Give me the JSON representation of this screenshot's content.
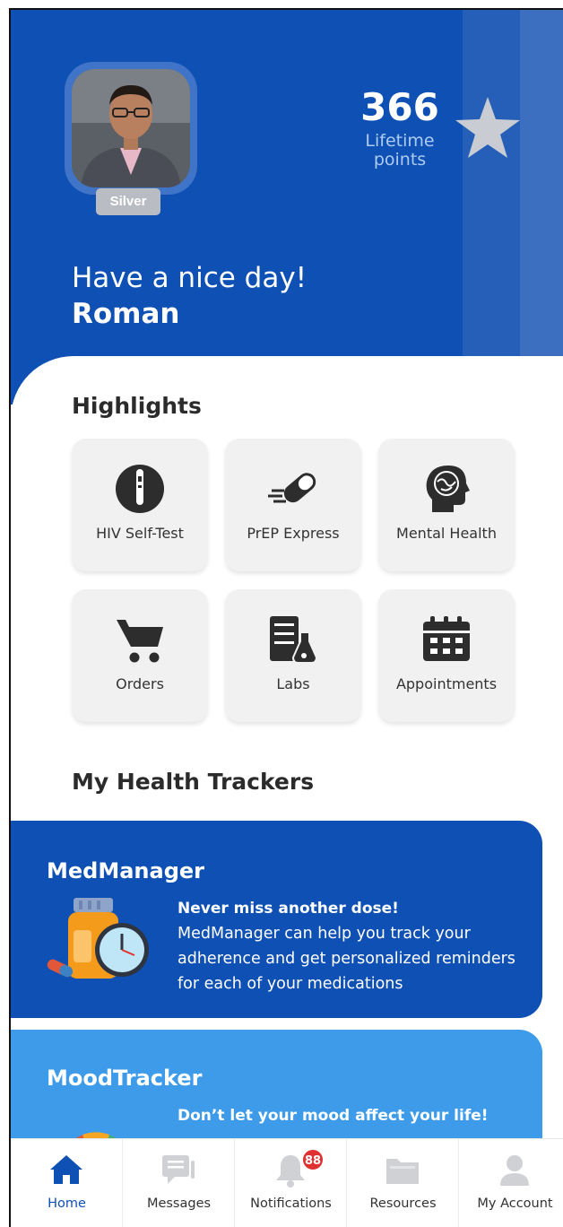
{
  "profile": {
    "tier": "Silver",
    "points_value": "366",
    "points_label_line1": "Lifetime",
    "points_label_line2": "points",
    "greeting": "Have a nice day!",
    "user_name": "Roman"
  },
  "highlights": {
    "title": "Highlights",
    "items": [
      {
        "label": "HIV Self-Test",
        "icon": "test-kit-icon"
      },
      {
        "label": "PrEP Express",
        "icon": "pill-express-icon"
      },
      {
        "label": "Mental Health",
        "icon": "brain-head-icon"
      },
      {
        "label": "Orders",
        "icon": "cart-icon"
      },
      {
        "label": "Labs",
        "icon": "lab-flask-icon"
      },
      {
        "label": "Appointments",
        "icon": "calendar-icon"
      }
    ]
  },
  "trackers": {
    "title": "My Health Trackers",
    "cards": [
      {
        "title": "MedManager",
        "headline": "Never miss another dose!",
        "body": "MedManager can help you track your adherence and get personalized reminders for each of your medications",
        "color": "#0e50b3",
        "icon": "pill-bottle-clock-icon"
      },
      {
        "title": "MoodTracker",
        "headline": "Don’t let your mood affect your life!",
        "color": "#3d9be9",
        "icon": "mood-gauge-icon"
      }
    ]
  },
  "nav": {
    "items": [
      {
        "label": "Home",
        "icon": "home-icon",
        "active": true
      },
      {
        "label": "Messages",
        "icon": "messages-icon"
      },
      {
        "label": "Notifications",
        "icon": "bell-icon",
        "badge": "88"
      },
      {
        "label": "Resources",
        "icon": "folder-icon"
      },
      {
        "label": "My Account",
        "icon": "user-icon"
      }
    ]
  },
  "colors": {
    "brand_blue": "#0e50b3",
    "light_blue": "#3d9be9",
    "badge_red": "#e03131"
  }
}
